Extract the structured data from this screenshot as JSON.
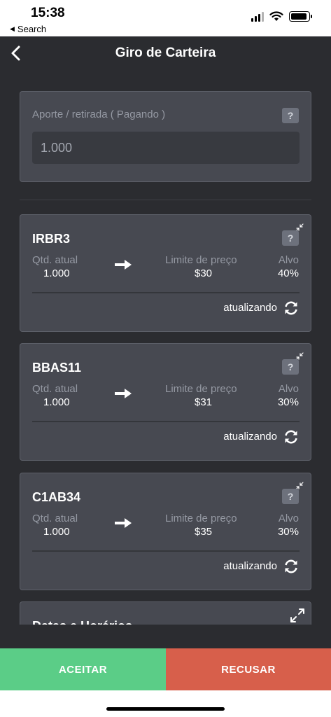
{
  "status_bar": {
    "time": "15:38",
    "back_label": "Search",
    "battery_level": 0.9,
    "signal_bars_active": 3
  },
  "nav": {
    "title": "Giro de Carteira"
  },
  "aporte": {
    "label": "Aporte / retirada ( Pagando )",
    "help": "?",
    "placeholder": "1.000"
  },
  "assets": [
    {
      "name": "IRBR3",
      "help": "?",
      "qtd_label": "Qtd. atual",
      "qtd_value": "1.000",
      "limit_label": "Limite de preço",
      "limit_value": "$30",
      "target_label": "Alvo",
      "target_value": "40%",
      "status": "atualizando"
    },
    {
      "name": "BBAS11",
      "help": "?",
      "qtd_label": "Qtd. atual",
      "qtd_value": "1.000",
      "limit_label": "Limite de preço",
      "limit_value": "$31",
      "target_label": "Alvo",
      "target_value": "30%",
      "status": "atualizando"
    },
    {
      "name": "C1AB34",
      "help": "?",
      "qtd_label": "Qtd. atual",
      "qtd_value": "1.000",
      "limit_label": "Limite de preço",
      "limit_value": "$35",
      "target_label": "Alvo",
      "target_value": "30%",
      "status": "atualizando"
    }
  ],
  "dates_section": {
    "title": "Datas e Horários"
  },
  "actions": {
    "accept_label": "ACEITAR",
    "reject_label": "RECUSAR"
  },
  "colors": {
    "background": "#2b2c30",
    "card": "#474951",
    "accept": "#5bcd87",
    "reject": "#d75f4b"
  },
  "icons": {
    "back": "chevron-left-icon",
    "help": "question-icon",
    "compress": "compress-icon",
    "arrow": "arrow-right-icon",
    "refresh": "refresh-icon",
    "expand": "expand-icon"
  }
}
